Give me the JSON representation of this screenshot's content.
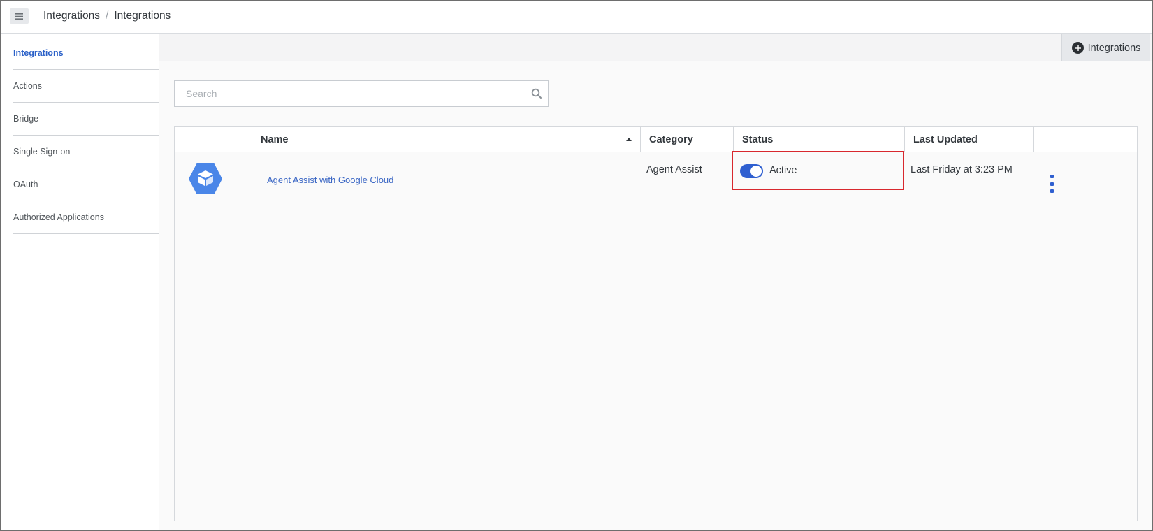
{
  "header": {
    "menu_icon": "hamburger-icon",
    "breadcrumb": [
      "Integrations",
      "Integrations"
    ],
    "separator": "/"
  },
  "sidebar": {
    "items": [
      {
        "label": "Integrations",
        "active": true
      },
      {
        "label": "Actions",
        "active": false
      },
      {
        "label": "Bridge",
        "active": false
      },
      {
        "label": "Single Sign-on",
        "active": false
      },
      {
        "label": "OAuth",
        "active": false
      },
      {
        "label": "Authorized Applications",
        "active": false
      }
    ]
  },
  "toolbar": {
    "add_label": "Integrations",
    "add_icon": "plus-circle-icon"
  },
  "search": {
    "placeholder": "Search",
    "value": "",
    "icon": "search-icon"
  },
  "table": {
    "columns": [
      "",
      "Name",
      "Category",
      "Status",
      "Last Updated",
      ""
    ],
    "sort": {
      "column": "Name",
      "direction": "ascending"
    },
    "rows": [
      {
        "logo_icon": "agent-assist-hexagon-icon",
        "name": "Agent Assist with Google Cloud",
        "category": "Agent Assist",
        "status": "Active",
        "status_on": true,
        "last_updated": "Last Friday at 3:23 PM",
        "menu_icon": "kebab-menu-icon"
      }
    ]
  },
  "colors": {
    "accent": "#2f5fd0",
    "link": "#3a66c4",
    "highlight_border": "#d8282e",
    "logo_blue": "#4a86e8"
  }
}
